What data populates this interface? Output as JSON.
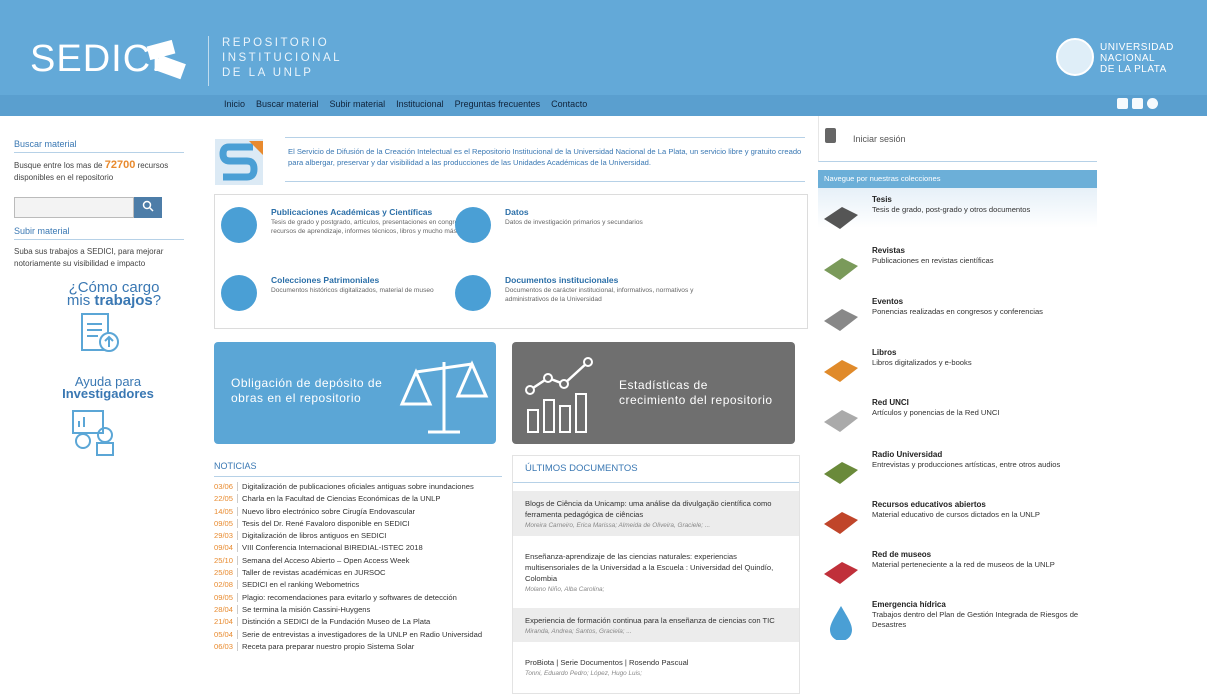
{
  "header": {
    "logo": "SEDICI",
    "repo_lines": [
      "REPOSITORIO",
      "INSTITUCIONAL",
      "DE LA UNLP"
    ],
    "unlp_lines": [
      "UNIVERSIDAD",
      "NACIONAL",
      "DE LA PLATA"
    ]
  },
  "nav": {
    "items": [
      "Inicio",
      "Buscar material",
      "Subir material",
      "Institucional",
      "Preguntas frecuentes",
      "Contacto"
    ]
  },
  "left": {
    "buscar_title": "Buscar material",
    "buscar_text_pre": "Busque entre los mas de",
    "buscar_count": "72700",
    "buscar_text_post": "recursos disponibles en el repositorio",
    "search_placeholder": "",
    "subir_title": "Subir material",
    "subir_text": "Suba sus trabajos a SEDICI, para mejorar notoriamente su visibilidad e impacto",
    "como_line1": "¿Cómo cargo",
    "como_line2_a": "mis",
    "como_line2_b": "trabajos",
    "como_line2_c": "?",
    "ayuda_line1": "Ayuda para",
    "ayuda_line2": "Investigadores"
  },
  "intro": {
    "text": "El Servicio de Difusión de la Creación Intelectual es el Repositorio Institucional de la Universidad Nacional de La Plata, un servicio libre y gratuito creado para albergar, preservar y dar visibilidad a las producciones de las Unidades Académicas de la Universidad."
  },
  "categories": [
    {
      "title": "Publicaciones Académicas y Científicas",
      "desc": "Tesis de grado y postgrado, artículos, presentaciones en congresos, recursos de aprendizaje, informes técnicos, libros y mucho más"
    },
    {
      "title": "Datos",
      "desc": "Datos de investigación primarios y secundarios"
    },
    {
      "title": "Colecciones Patrimoniales",
      "desc": "Documentos históricos digitalizados, material de museo"
    },
    {
      "title": "Documentos institucionales",
      "desc": "Documentos de carácter institucional, informativos, normativos y administrativos de la Universidad"
    }
  ],
  "banners": {
    "left_line1": "Obligación de depósito de",
    "left_line2": "obras en el repositorio",
    "right_line1": "Estadísticas de",
    "right_line2": "crecimiento del repositorio",
    "left_color": "#5ba6d6",
    "right_color": "#6f6f6f"
  },
  "noticias": {
    "title": "NOTICIAS",
    "items": [
      {
        "date": "03/06",
        "text": "Digitalización de publicaciones oficiales antiguas sobre inundaciones"
      },
      {
        "date": "22/05",
        "text": "Charla en la Facultad de Ciencias Económicas de la UNLP"
      },
      {
        "date": "14/05",
        "text": "Nuevo libro electrónico sobre Cirugía Endovascular"
      },
      {
        "date": "09/05",
        "text": "Tesis del Dr. René Favaloro disponible en SEDICI"
      },
      {
        "date": "29/03",
        "text": "Digitalización de libros antiguos en SEDICI"
      },
      {
        "date": "09/04",
        "text": "VIII Conferencia Internacional BIREDIAL-ISTEC 2018"
      },
      {
        "date": "25/10",
        "text": "Semana del Acceso Abierto – Open Access Week"
      },
      {
        "date": "25/08",
        "text": "Taller de revistas académicas en JURSOC"
      },
      {
        "date": "02/08",
        "text": "SEDICI en el ranking Webometrics"
      },
      {
        "date": "09/05",
        "text": "Plagio: recomendaciones para evitarlo y softwares de detección"
      },
      {
        "date": "28/04",
        "text": "Se termina la misión Cassini-Huygens"
      },
      {
        "date": "21/04",
        "text": "Distinción a SEDICI de la Fundación Museo de La Plata"
      },
      {
        "date": "05/04",
        "text": "Serie de entrevistas a investigadores de la UNLP en Radio Universidad"
      },
      {
        "date": "06/03",
        "text": "Receta para preparar nuestro propio Sistema Solar"
      }
    ]
  },
  "ultimos": {
    "title": "ÚLTIMOS DOCUMENTOS",
    "items": [
      {
        "title": "Blogs de Ciência da Unicamp: uma análise da divulgação científica como ferramenta pedagógica de ciências",
        "authors": "Moreira Carneiro, Erica Marissa; Almeida de Oliveira, Graciele; ..."
      },
      {
        "title": "Enseñanza-aprendizaje de las ciencias naturales: experiencias multisensoriales de la Universidad a la Escuela : Universidad del Quindío, Colombia",
        "authors": "Molano Niño, Alba Carolina;"
      },
      {
        "title": "Experiencia de formación continua para la enseñanza de ciencias con TIC",
        "authors": "Miranda, Andrea; Santos, Graciela; ..."
      },
      {
        "title": "ProBiota | Serie Documentos | Rosendo Pascual",
        "authors": "Tonni, Eduardo Pedro; López, Hugo Luis;"
      }
    ]
  },
  "right": {
    "login": "Iniciar sesión",
    "colecciones_header": "Navegue por nuestras colecciones",
    "collections": [
      {
        "title": "Tesis",
        "desc": "Tesis de grado, post-grado y otros documentos",
        "icon": "graduation-cap-icon"
      },
      {
        "title": "Revistas",
        "desc": "Publicaciones en revistas científicas",
        "icon": "journals-icon"
      },
      {
        "title": "Eventos",
        "desc": "Ponencias realizadas en congresos y conferencias",
        "icon": "microphone-icon"
      },
      {
        "title": "Libros",
        "desc": "Libros digitalizados y e-books",
        "icon": "book-icon"
      },
      {
        "title": "Red UNCI",
        "desc": "Artículos y ponencias de la Red UNCI",
        "icon": "network-icon"
      },
      {
        "title": "Radio Universidad",
        "desc": "Entrevistas y producciones artísticas, entre otros audios",
        "icon": "radio-icon"
      },
      {
        "title": "Recursos educativos abiertos",
        "desc": "Material educativo de cursos dictados en la UNLP",
        "icon": "education-icon"
      },
      {
        "title": "Red de museos",
        "desc": "Material perteneciente a la red de museos de la UNLP",
        "icon": "museum-icon"
      },
      {
        "title": "Emergencia hídrica",
        "desc": "Trabajos dentro del Plan de Gestión Integrada de Riesgos de Desastres",
        "icon": "water-drop-icon"
      }
    ]
  }
}
